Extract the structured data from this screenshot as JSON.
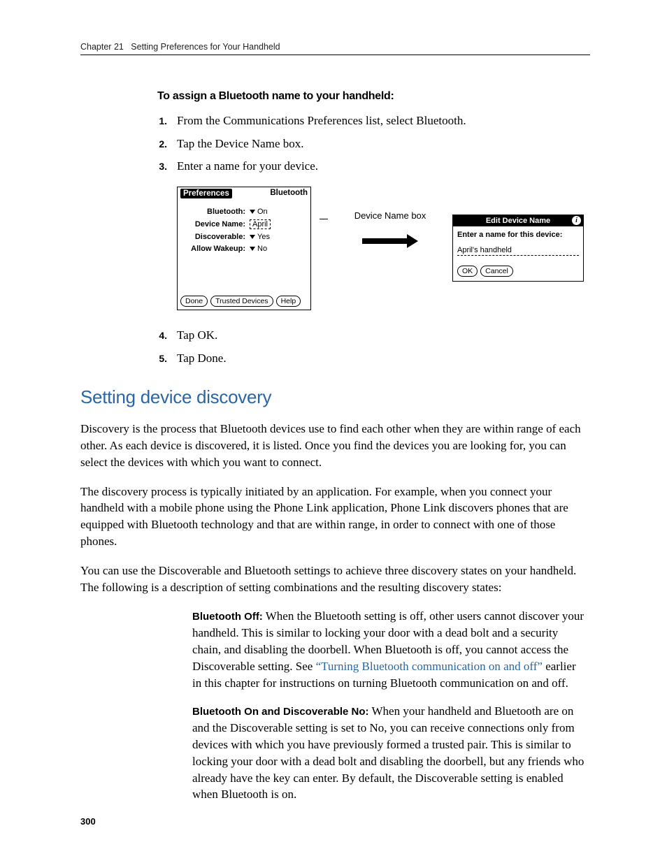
{
  "header": {
    "chapter": "Chapter 21",
    "title": "Setting Preferences for Your Handheld"
  },
  "subhead1": "To assign a Bluetooth name to your handheld:",
  "steps_a": {
    "1": "From the Communications Preferences list, select Bluetooth.",
    "2": "Tap the Device Name box.",
    "3": "Enter a name for your device."
  },
  "palm": {
    "title_left": "Preferences",
    "title_right": "Bluetooth",
    "bluetooth_label": "Bluetooth:",
    "bluetooth_value": "On",
    "device_name_label": "Device Name:",
    "device_name_value": "April",
    "discoverable_label": "Discoverable:",
    "discoverable_value": "Yes",
    "allow_wakeup_label": "Allow Wakeup:",
    "allow_wakeup_value": "No",
    "btn_done": "Done",
    "btn_trusted": "Trusted Devices",
    "btn_help": "Help"
  },
  "callout_label": "Device Name box",
  "dialog": {
    "title": "Edit Device Name",
    "prompt": "Enter a name for this device:",
    "value": "April's handheld",
    "btn_ok": "OK",
    "btn_cancel": "Cancel"
  },
  "steps_b": {
    "4": "Tap OK.",
    "5": "Tap Done."
  },
  "section_title": "Setting device discovery",
  "para1": "Discovery is the process that Bluetooth devices use to find each other when they are within range of each other. As each device is discovered, it is listed. Once you find the devices you are looking for, you can select the devices with which you want to connect.",
  "para2": "The discovery process is typically initiated by an application. For example, when you connect your handheld with a mobile phone using the Phone Link application, Phone Link discovers phones that are equipped with Bluetooth technology and that are within range, in order to connect with one of those phones.",
  "para3": "You can use the Discoverable and Bluetooth settings to achieve three discovery states on your handheld. The following is a description of setting combinations and the resulting discovery states:",
  "state1": {
    "title": "Bluetooth Off:",
    "body_pre": " When the Bluetooth setting is off, other users cannot discover your handheld. This is similar to locking your door with a dead bolt and a security chain, and disabling the doorbell. When Bluetooth is off, you cannot access the Discoverable setting. See ",
    "link": "“Turning Bluetooth communication on and off”",
    "body_post": " earlier in this chapter for instructions on turning Bluetooth communication on and off."
  },
  "state2": {
    "title": "Bluetooth On and Discoverable No:",
    "body": " When your handheld and Bluetooth are on and the Discoverable setting is set to No, you can receive connections only from devices with which you have previously formed a trusted pair. This is similar to locking your door with a dead bolt and disabling the doorbell, but any friends who already have the key can enter. By default, the Discoverable setting is enabled when Bluetooth is on."
  },
  "page_number": "300"
}
